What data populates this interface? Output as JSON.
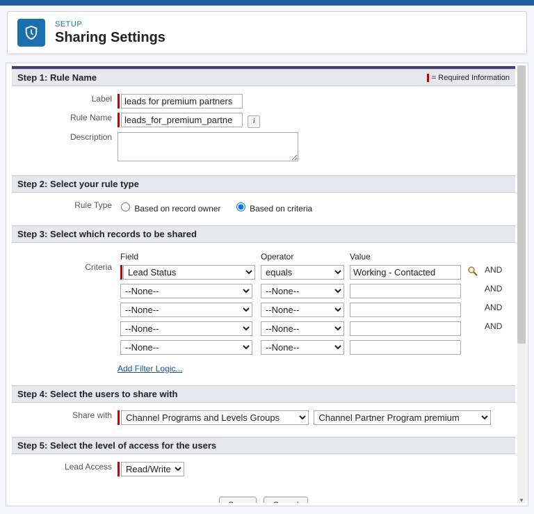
{
  "header": {
    "setup": "SETUP",
    "title": "Sharing Settings"
  },
  "step1": {
    "title": "Step 1: Rule Name",
    "required_note": "= Required Information",
    "label_lbl": "Label",
    "label_val": "leads for premium partners",
    "rulename_lbl": "Rule Name",
    "rulename_val": "leads_for_premium_partne",
    "description_lbl": "Description",
    "description_val": ""
  },
  "step2": {
    "title": "Step 2: Select your rule type",
    "ruletype_lbl": "Rule Type",
    "opt_owner": "Based on record owner",
    "opt_criteria": "Based on criteria"
  },
  "step3": {
    "title": "Step 3: Select which records to be shared",
    "criteria_lbl": "Criteria",
    "col_field": "Field",
    "col_operator": "Operator",
    "col_value": "Value",
    "rows": [
      {
        "field": "Lead Status",
        "operator": "equals",
        "value": "Working - Contacted",
        "and": "AND"
      },
      {
        "field": "--None--",
        "operator": "--None--",
        "value": "",
        "and": "AND"
      },
      {
        "field": "--None--",
        "operator": "--None--",
        "value": "",
        "and": "AND"
      },
      {
        "field": "--None--",
        "operator": "--None--",
        "value": "",
        "and": "AND"
      },
      {
        "field": "--None--",
        "operator": "--None--",
        "value": "",
        "and": ""
      }
    ],
    "add_filter": "Add Filter Logic..."
  },
  "step4": {
    "title": "Step 4: Select the users to share with",
    "sharewith_lbl": "Share with",
    "category": "Channel Programs and Levels Groups",
    "group": "Channel Partner Program premium"
  },
  "step5": {
    "title": "Step 5: Select the level of access for the users",
    "leadaccess_lbl": "Lead Access",
    "leadaccess_val": "Read/Write"
  },
  "buttons": {
    "save": "Save",
    "cancel": "Cancel"
  }
}
